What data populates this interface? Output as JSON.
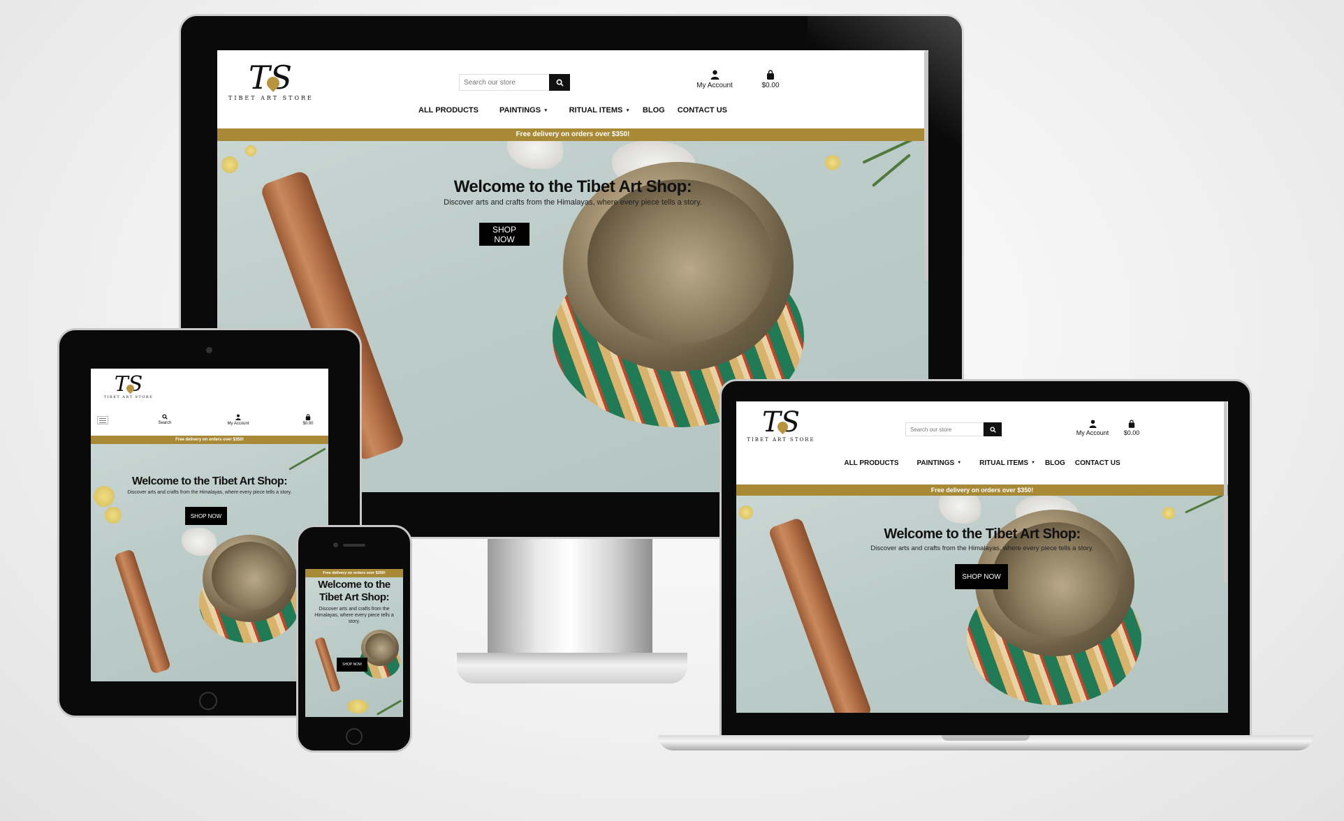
{
  "site": {
    "logo_mark": "TS",
    "logo_text": "TIBET ART STORE",
    "search_placeholder": "Search our store",
    "search_label": "Search",
    "account_label": "My Account",
    "cart_total": "$0.00",
    "nav": [
      {
        "label": "ALL PRODUCTS"
      },
      {
        "label": "PAINTINGS"
      },
      {
        "label": "RITUAL ITEMS"
      },
      {
        "label": "BLOG"
      },
      {
        "label": "CONTACT US"
      }
    ],
    "banner": "Free delivery on orders over $350!",
    "hero_title": "Welcome to the Tibet Art Shop:",
    "hero_subtitle": "Discover arts and crafts from the Himalayas, where every piece tells a story.",
    "cta": "SHOP NOW"
  },
  "colors": {
    "accent_gold": "#a88936",
    "button_black": "#000000",
    "device_bezel": "#0a0a0a"
  },
  "icons": [
    "search-icon",
    "user-icon",
    "shopping-bag-icon",
    "hamburger-menu-icon",
    "caret-down-icon"
  ]
}
